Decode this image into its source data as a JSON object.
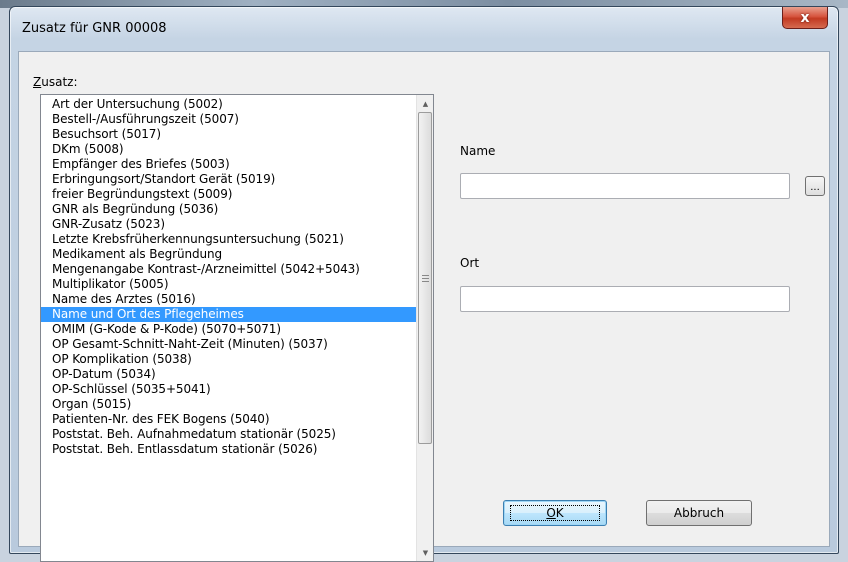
{
  "window": {
    "title": "Zusatz für GNR 00008",
    "close_label": "x"
  },
  "list": {
    "label_mnemonic": "Z",
    "label_rest": "usatz:",
    "items": [
      "Art der Untersuchung (5002)",
      "Bestell-/Ausführungszeit (5007)",
      "Besuchsort (5017)",
      "DKm (5008)",
      "Empfänger des Briefes (5003)",
      "Erbringungsort/Standort Gerät (5019)",
      "freier Begründungstext (5009)",
      "GNR als Begründung (5036)",
      "GNR-Zusatz (5023)",
      "Letzte Krebsfrüherkennungsuntersuchung (5021)",
      "Medikament als Begründung",
      "Mengenangabe Kontrast-/Arzneimittel (5042+5043)",
      "Multiplikator (5005)",
      "Name des Arztes (5016)",
      "Name und Ort des Pflegeheimes",
      "OMIM (G-Kode & P-Kode) (5070+5071)",
      "OP Gesamt-Schnitt-Naht-Zeit (Minuten) (5037)",
      "OP Komplikation (5038)",
      "OP-Datum (5034)",
      "OP-Schlüssel (5035+5041)",
      "Organ (5015)",
      "Patienten-Nr. des FEK Bogens (5040)",
      "Poststat. Beh. Aufnahmedatum stationär (5025)",
      "Poststat. Beh. Entlassdatum stationär (5026)"
    ],
    "selected_index": 14
  },
  "form": {
    "name_label": "Name",
    "name_value": "",
    "browse_label": "...",
    "ort_label": "Ort",
    "ort_value": ""
  },
  "buttons": {
    "ok_mnemonic": "O",
    "ok_rest": "K",
    "cancel_label": "Abbruch"
  },
  "colors": {
    "selection": "#3399ff",
    "close_button": "#c23a22"
  }
}
